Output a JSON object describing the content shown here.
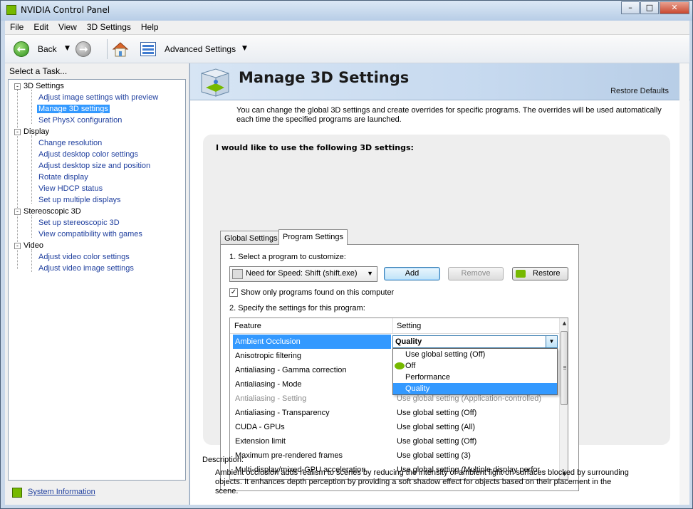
{
  "window": {
    "title": "NVIDIA Control Panel",
    "controls": [
      "–",
      "□",
      "✕"
    ]
  },
  "menu": [
    "File",
    "Edit",
    "View",
    "3D Settings",
    "Help"
  ],
  "toolbar": {
    "back_label": "Back",
    "advanced_label": "Advanced Settings"
  },
  "left": {
    "task_header": "Select a Task...",
    "categories": [
      {
        "label": "3D Settings",
        "items": [
          "Adjust image settings with preview",
          "Manage 3D settings",
          "Set PhysX configuration"
        ]
      },
      {
        "label": "Display",
        "items": [
          "Change resolution",
          "Adjust desktop color settings",
          "Adjust desktop size and position",
          "Rotate display",
          "View HDCP status",
          "Set up multiple displays"
        ]
      },
      {
        "label": "Stereoscopic 3D",
        "items": [
          "Set up stereoscopic 3D",
          "View compatibility with games"
        ]
      },
      {
        "label": "Video",
        "items": [
          "Adjust video color settings",
          "Adjust video image settings"
        ]
      }
    ],
    "selected_item": "Manage 3D settings",
    "system_info": "System Information"
  },
  "main": {
    "title": "Manage 3D Settings",
    "restore_defaults": "Restore Defaults",
    "intro": "You can change the global 3D settings and create overrides for specific programs. The overrides will be used automatically each time the specified programs are launched.",
    "section_heading": "I would like to use the following 3D settings:",
    "tabs": [
      "Global Settings",
      "Program Settings"
    ],
    "active_tab": "Program Settings",
    "step1": "1. Select a program to customize:",
    "program_selected": "Need for Speed: Shift (shift.exe)",
    "buttons": {
      "add": "Add",
      "remove": "Remove",
      "restore": "Restore"
    },
    "checkbox_label": "Show only programs found on this computer",
    "checkbox_checked": true,
    "step2": "2. Specify the settings for this program:",
    "grid_headers": [
      "Feature",
      "Setting"
    ],
    "rows": [
      {
        "feature": "Ambient Occlusion",
        "setting": "Quality",
        "state": "selected"
      },
      {
        "feature": "Anisotropic filtering",
        "setting": "",
        "state": "normal"
      },
      {
        "feature": "Antialiasing - Gamma correction",
        "setting": "",
        "state": "normal"
      },
      {
        "feature": "Antialiasing - Mode",
        "setting": "",
        "state": "normal"
      },
      {
        "feature": "Antialiasing - Setting",
        "setting": "Use global setting (Application-controlled)",
        "state": "disabled"
      },
      {
        "feature": "Antialiasing - Transparency",
        "setting": "Use global setting (Off)",
        "state": "normal"
      },
      {
        "feature": "CUDA - GPUs",
        "setting": "Use global setting (All)",
        "state": "normal"
      },
      {
        "feature": "Extension limit",
        "setting": "Use global setting (Off)",
        "state": "normal"
      },
      {
        "feature": "Maximum pre-rendered frames",
        "setting": "Use global setting (3)",
        "state": "normal"
      },
      {
        "feature": "Multi-display/mixed-GPU acceleration",
        "setting": "Use global setting (Multiple display perfor...",
        "state": "normal"
      }
    ],
    "dropdown_options": [
      "Use global setting (Off)",
      "Off",
      "Performance",
      "Quality"
    ],
    "dropdown_highlighted": "Quality",
    "description_label": "Description:",
    "description": "Ambient occlusion adds realism to scenes by reducing the intensity of ambient light on surfaces blocked by surrounding objects. It enhances depth perception by providing a soft shadow effect for objects based on their placement in the scene."
  },
  "colors": {
    "selection": "#3399ff",
    "nvidia_green": "#76b900",
    "link": "#1f3f9e"
  }
}
